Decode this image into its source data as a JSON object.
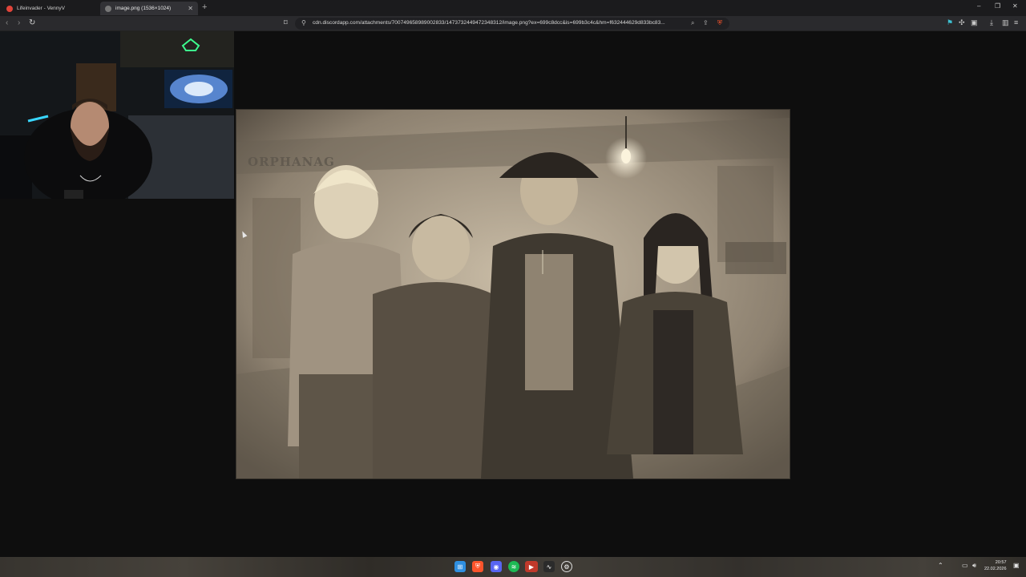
{
  "browser": {
    "tabs": [
      {
        "title": "Lifeinvader - VennyV",
        "active": false
      },
      {
        "title": "image.png (1536×1024)",
        "active": true
      }
    ],
    "address": "cdn.discordapp.com/attachments/700749658989002833/1473732449472348312/image.png?ex=699c8dcc&is=699b3c4c&hm=f632444629d833bc83..."
  },
  "image": {
    "sign_text": "ORPHANAG"
  },
  "taskbar": {
    "clock_time": "20:57",
    "clock_date": "22.02.2026"
  },
  "colors": {
    "accent_red": "#e0443a",
    "spotify_green": "#1db954",
    "brave_orange": "#fb542b"
  }
}
